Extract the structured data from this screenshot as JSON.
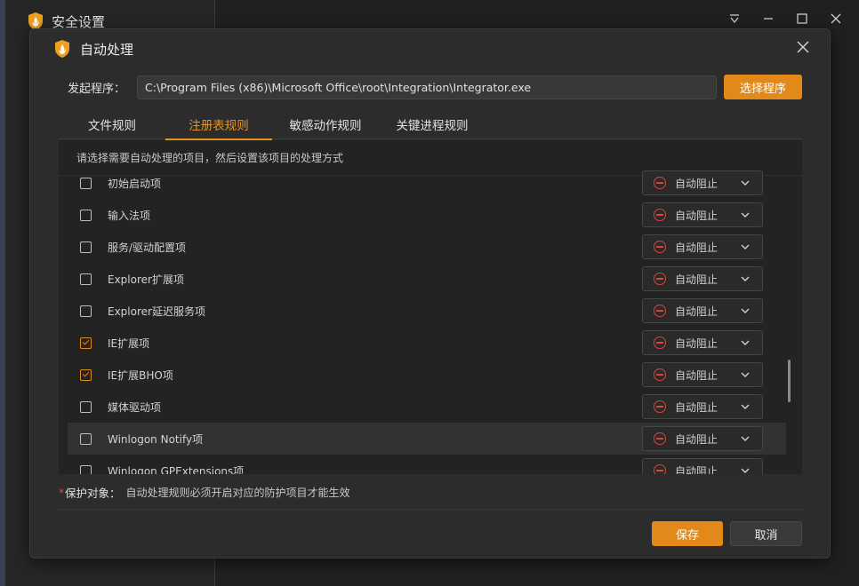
{
  "window": {
    "title": "安全设置"
  },
  "dialog": {
    "title": "自动处理",
    "launcher_label": "发起程序：",
    "launcher_path": "C:\\Program Files (x86)\\Microsoft Office\\root\\Integration\\Integrator.exe",
    "choose_button": "选择程序",
    "tabs": [
      {
        "label": "文件规则",
        "active": false
      },
      {
        "label": "注册表规则",
        "active": true
      },
      {
        "label": "敏感动作规则",
        "active": false
      },
      {
        "label": "关键进程规则",
        "active": false
      }
    ],
    "hint": "请选择需要自动处理的项目，然后设置该项目的处理方式",
    "rows": [
      {
        "label": "初始启动项",
        "checked": false,
        "action": "自动阻止"
      },
      {
        "label": "输入法项",
        "checked": false,
        "action": "自动阻止"
      },
      {
        "label": "服务/驱动配置项",
        "checked": false,
        "action": "自动阻止"
      },
      {
        "label": "Explorer扩展项",
        "checked": false,
        "action": "自动阻止"
      },
      {
        "label": "Explorer延迟服务项",
        "checked": false,
        "action": "自动阻止"
      },
      {
        "label": "IE扩展项",
        "checked": true,
        "action": "自动阻止"
      },
      {
        "label": "IE扩展BHO项",
        "checked": true,
        "action": "自动阻止"
      },
      {
        "label": "媒体驱动项",
        "checked": false,
        "action": "自动阻止"
      },
      {
        "label": "Winlogon Notify项",
        "checked": false,
        "action": "自动阻止"
      },
      {
        "label": "Winlogon GPExtensions项",
        "checked": false,
        "action": "自动阻止"
      }
    ],
    "protect_key": "保护对象：",
    "required_mark": "*",
    "protect_text": "自动处理规则必须开启对应的防护项目才能生效",
    "save_button": "保存",
    "cancel_button": "取消"
  },
  "colors": {
    "accent": "#e3891a",
    "block_red": "#d4453b",
    "background": "#2c2c2c"
  }
}
